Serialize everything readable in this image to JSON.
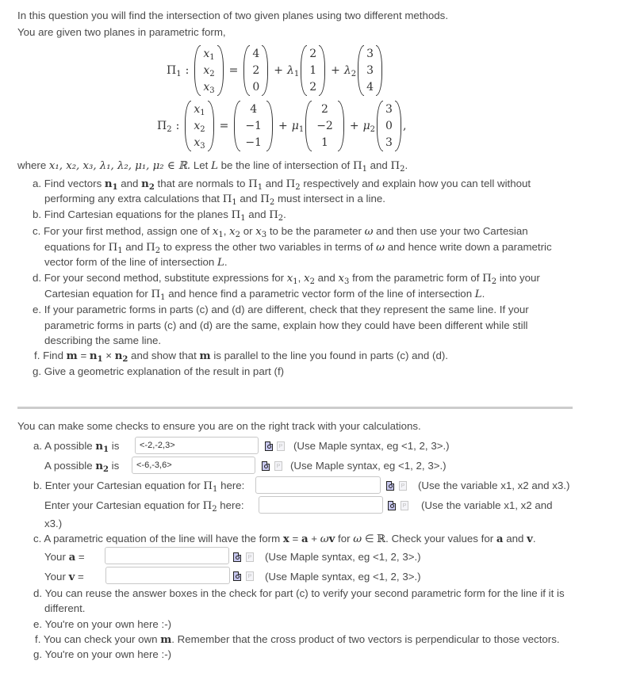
{
  "intro": {
    "line1": "In this question you will find the intersection of two given planes using two different methods.",
    "line2": "You are given two planes in parametric form,"
  },
  "plane1": {
    "name": "Π",
    "sub": "1",
    "lhs": [
      "x1",
      "x2",
      "x3"
    ],
    "point": [
      "4",
      "2",
      "0"
    ],
    "param1": "λ",
    "dir1": [
      "2",
      "1",
      "2"
    ],
    "param2": "λ",
    "dir2": [
      "3",
      "3",
      "4"
    ]
  },
  "plane2": {
    "name": "Π",
    "sub": "2",
    "lhs": [
      "x1",
      "x2",
      "x3"
    ],
    "point": [
      "4",
      "−1",
      "−1"
    ],
    "param1": "μ",
    "dir1": [
      "2",
      "−2",
      "1"
    ],
    "param2": "μ",
    "dir2": [
      "3",
      "0",
      "3"
    ]
  },
  "where_line": {
    "prefix": "where",
    "vars": "x₁, x₂, x₃, λ₁, λ₂, μ₁, μ₂ ∈ ℝ.",
    "text": "Let",
    "L": "L",
    "text2": "be the line of intersection of",
    "and": "and"
  },
  "parts": {
    "a": {
      "label": "a.",
      "t1": "Find vectors",
      "t2": "and",
      "t3": "that are normals to",
      "t4": "and",
      "t5": "respectively and explain how you can tell without",
      "t6": "performing any extra calculations that",
      "t7": "and",
      "t8": "must intersect in a line."
    },
    "b": {
      "label": "b.",
      "t1": "Find Cartesian equations for the planes",
      "t2": "and"
    },
    "c": {
      "label": "c.",
      "t1": "For your first method, assign one of",
      "t2": "or",
      "t3": "to be the parameter",
      "t4": "and then use your two Cartesian",
      "t5": "equations for",
      "t6": "and",
      "t7": "to express the other two variables in terms of",
      "t8": "and hence write down a parametric",
      "t9": "vector form of the line of intersection"
    },
    "d": {
      "label": "d.",
      "t1": "For your second method, substitute expressions for",
      "t2": "and",
      "t3": "from the parametric form of",
      "t4": "into your",
      "t5": "Cartesian equation for",
      "t6": "and hence find a parametric vector form of the line of intersection"
    },
    "e": {
      "label": "e.",
      "l1": "If your parametric forms in parts (c) and (d) are different, check that they represent the same line.  If your",
      "l2": "parametric forms in parts (c) and (d) are the same, explain how they could have been different while still",
      "l3": "describing the same line."
    },
    "f": {
      "label": "f.",
      "t1": "Find",
      "t2": "and show that",
      "t3": "is parallel to the line you found in parts (c) and (d)."
    },
    "g": {
      "label": "g.",
      "t1": "Give a geometric explanation of the result in part (f)"
    }
  },
  "checks": {
    "intro": "You can make some checks to ensure you are on the right track with your calculations.",
    "a": {
      "label": "a.",
      "n1_prefix": "A possible",
      "n1_suffix": "is",
      "n1_value": "<-2,-2,3>",
      "n1_hint": "(Use Maple syntax, eg <1, 2, 3>.)",
      "n2_prefix": "A possible",
      "n2_suffix": "is",
      "n2_value": "<-6,-3,6>",
      "n2_hint": "(Use Maple syntax, eg <1, 2, 3>.)"
    },
    "b": {
      "label": "b.",
      "p1_text": "Enter your Cartesian equation for",
      "p1_suffix": "here:",
      "p1_value": "",
      "p1_hint": "(Use the variable x1, x2 and x3.)",
      "p2_text": "Enter your Cartesian equation for",
      "p2_suffix": "here:",
      "p2_value": "",
      "p2_hint": "(Use the variable x1, x2 and",
      "p2_hint_wrap": "x3.)"
    },
    "c": {
      "label": "c.",
      "t1": "A parametric equation of the line will have the form",
      "t2": "for",
      "t3": "Check your values for",
      "t4": "and",
      "a_prefix": "Your",
      "a_value": "",
      "a_hint": "(Use Maple syntax, eg <1, 2, 3>.)",
      "v_prefix": "Your",
      "v_value": "",
      "v_hint": "(Use Maple syntax, eg <1, 2, 3>.)"
    },
    "d": {
      "label": "d.",
      "l1": "You can reuse the answer boxes in the check for part (c) to verify your second parametric form for the line if it is",
      "l2": "different."
    },
    "e": {
      "label": "e.",
      "text": "You're on your own here :-)"
    },
    "f": {
      "label": "f.",
      "t1": "You can check your own",
      "t2": ".  Remember that the cross product of two vectors is perpendicular to those vectors."
    },
    "g": {
      "label": "g.",
      "text": "You're on your own here :-)"
    }
  },
  "icons": {
    "preview": "preview-icon",
    "maple_syntax": "maple-syntax-icon"
  }
}
